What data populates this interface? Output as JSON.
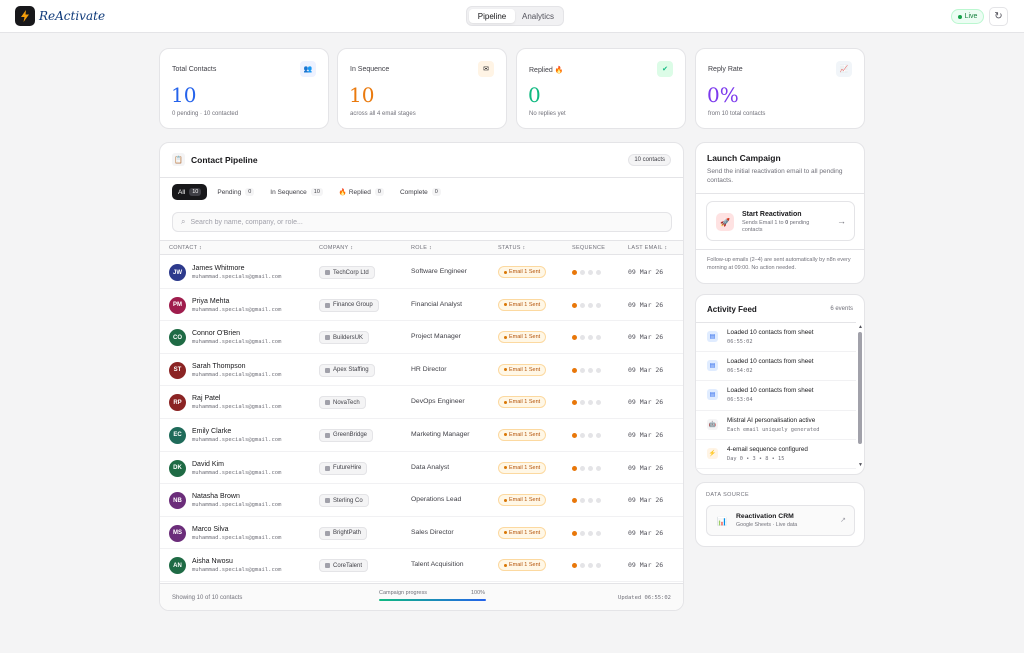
{
  "app": {
    "logo_text": "ReActivate",
    "logo_icon": "bolt-icon"
  },
  "nav": {
    "tabs": [
      {
        "label": "Pipeline",
        "active": true
      },
      {
        "label": "Analytics",
        "active": false
      }
    ]
  },
  "header": {
    "live_label": "Live",
    "refresh_icon": "refresh-icon"
  },
  "stats": [
    {
      "label": "Total Contacts",
      "value": "10",
      "sub": "0 pending · 10 contacted",
      "icon": "users-icon",
      "color": "#2563eb"
    },
    {
      "label": "In Sequence",
      "value": "10",
      "sub": "across all 4 email stages",
      "icon": "mail-icon",
      "color": "#ea7a0e"
    },
    {
      "label": "Replied 🔥",
      "value": "0",
      "sub": "No replies yet",
      "icon": "check-icon",
      "color": "#10b981"
    },
    {
      "label": "Reply Rate",
      "value": "0%",
      "sub": "from 10 total contacts",
      "icon": "chart-icon",
      "color": "#7c3aed"
    }
  ],
  "pipeline": {
    "title": "Contact Pipeline",
    "count_badge": "10 contacts",
    "filters": [
      {
        "label": "All",
        "count": "10",
        "active": true
      },
      {
        "label": "Pending",
        "count": "0",
        "active": false
      },
      {
        "label": "In Sequence",
        "count": "10",
        "active": false
      },
      {
        "label": "🔥 Replied",
        "count": "0",
        "active": false
      },
      {
        "label": "Complete",
        "count": "0",
        "active": false
      }
    ],
    "search_placeholder": "Search by name, company, or role...",
    "columns": [
      "CONTACT ↕",
      "COMPANY ↕",
      "ROLE ↕",
      "STATUS ↕",
      "SEQUENCE",
      "LAST EMAIL ↕"
    ],
    "rows": [
      {
        "initials": "JW",
        "color": "#2d3a8c",
        "name": "James Whitmore",
        "email": "muhammad.specials@gmail.com",
        "company": "TechCorp Ltd",
        "role": "Software Engineer",
        "status": "Email 1 Sent",
        "sequence_step": 1,
        "last_email": "09 Mar 26"
      },
      {
        "initials": "PM",
        "color": "#9f1d4d",
        "name": "Priya Mehta",
        "email": "muhammad.specials@gmail.com",
        "company": "Finance Group",
        "role": "Financial Analyst",
        "status": "Email 1 Sent",
        "sequence_step": 1,
        "last_email": "09 Mar 26"
      },
      {
        "initials": "CO",
        "color": "#1f6b45",
        "name": "Connor O'Brien",
        "email": "muhammad.specials@gmail.com",
        "company": "BuildersUK",
        "role": "Project Manager",
        "status": "Email 1 Sent",
        "sequence_step": 1,
        "last_email": "09 Mar 26"
      },
      {
        "initials": "ST",
        "color": "#8b2424",
        "name": "Sarah Thompson",
        "email": "muhammad.specials@gmail.com",
        "company": "Apex Staffing",
        "role": "HR Director",
        "status": "Email 1 Sent",
        "sequence_step": 1,
        "last_email": "09 Mar 26"
      },
      {
        "initials": "RP",
        "color": "#8b2424",
        "name": "Raj Patel",
        "email": "muhammad.specials@gmail.com",
        "company": "NovaTech",
        "role": "DevOps Engineer",
        "status": "Email 1 Sent",
        "sequence_step": 1,
        "last_email": "09 Mar 26"
      },
      {
        "initials": "EC",
        "color": "#1f6b5a",
        "name": "Emily Clarke",
        "email": "muhammad.specials@gmail.com",
        "company": "GreenBridge",
        "role": "Marketing Manager",
        "status": "Email 1 Sent",
        "sequence_step": 1,
        "last_email": "09 Mar 26"
      },
      {
        "initials": "DK",
        "color": "#1f6b45",
        "name": "David Kim",
        "email": "muhammad.specials@gmail.com",
        "company": "FutureHire",
        "role": "Data Analyst",
        "status": "Email 1 Sent",
        "sequence_step": 1,
        "last_email": "09 Mar 26"
      },
      {
        "initials": "NB",
        "color": "#6b2d7a",
        "name": "Natasha Brown",
        "email": "muhammad.specials@gmail.com",
        "company": "Sterling Co",
        "role": "Operations Lead",
        "status": "Email 1 Sent",
        "sequence_step": 1,
        "last_email": "09 Mar 26"
      },
      {
        "initials": "MS",
        "color": "#6b2d7a",
        "name": "Marco Silva",
        "email": "muhammad.specials@gmail.com",
        "company": "BrightPath",
        "role": "Sales Director",
        "status": "Email 1 Sent",
        "sequence_step": 1,
        "last_email": "09 Mar 26"
      },
      {
        "initials": "AN",
        "color": "#1f6b45",
        "name": "Aisha Nwosu",
        "email": "muhammad.specials@gmail.com",
        "company": "CoreTalent",
        "role": "Talent Acquisition",
        "status": "Email 1 Sent",
        "sequence_step": 1,
        "last_email": "09 Mar 26"
      }
    ],
    "footer": {
      "showing": "Showing 10 of 10 contacts",
      "progress_label": "Campaign progress",
      "progress_pct": "100%",
      "progress_value": 100,
      "updated": "Updated 06:55:02"
    }
  },
  "launch": {
    "title": "Launch Campaign",
    "desc": "Send the initial reactivation email to all pending contacts.",
    "button_title": "Start Reactivation",
    "button_sub_pre": "Sends Email 1 to ",
    "button_sub_count": "0",
    "button_sub_post": " pending contacts",
    "note": "Follow-up emails (2–4) are sent automatically by n8n every morning at 09:00. No action needed."
  },
  "feed": {
    "title": "Activity Feed",
    "count": "6 events",
    "items": [
      {
        "text": "Loaded 10 contacts from sheet",
        "meta": "06:55:02",
        "icon": "sheet-icon",
        "bg": "#e0ecff"
      },
      {
        "text": "Loaded 10 contacts from sheet",
        "meta": "06:54:02",
        "icon": "sheet-icon",
        "bg": "#e0ecff"
      },
      {
        "text": "Loaded 10 contacts from sheet",
        "meta": "06:53:04",
        "icon": "sheet-icon",
        "bg": "#e0ecff"
      },
      {
        "text": "Mistral AI personalisation active",
        "meta": "Each email uniquely generated",
        "icon": "robot-icon",
        "bg": "#f4f4f5"
      },
      {
        "text": "4-email sequence configured",
        "meta": "Day 0 • 3 • 8 • 15",
        "icon": "bolt-icon",
        "bg": "#fff4e5"
      }
    ]
  },
  "data_source": {
    "label": "DATA SOURCE",
    "name": "Reactivation CRM",
    "sub": "Google Sheets · Live data"
  }
}
